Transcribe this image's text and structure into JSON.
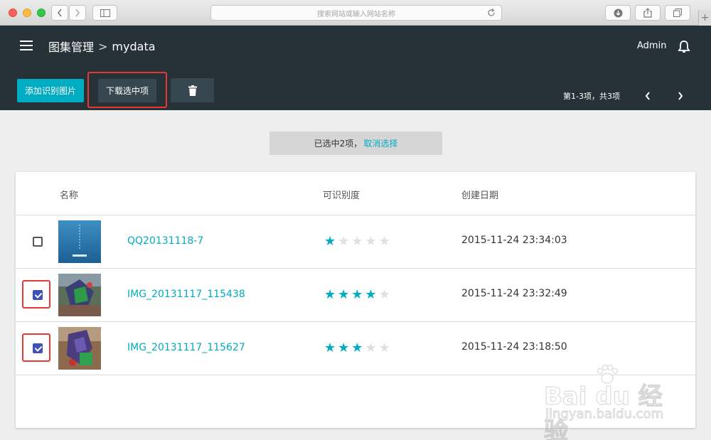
{
  "browser": {
    "url_placeholder": "搜索网站或输入网站名称"
  },
  "header": {
    "breadcrumb_root": "图集管理",
    "breadcrumb_sep": ">",
    "breadcrumb_current": "mydata",
    "user": "Admin"
  },
  "toolbar": {
    "add_label": "添加识别图片",
    "download_label": "下载选中项",
    "pagination_text": "第1-3项，共3项"
  },
  "selection": {
    "text": "已选中2项，",
    "cancel_label": "取消选择"
  },
  "table": {
    "columns": [
      "名称",
      "可识别度",
      "创建日期"
    ],
    "rows": [
      {
        "name": "QQ20131118-7",
        "rating": 1,
        "max_rating": 5,
        "date": "2015-11-24 23:34:03",
        "checked": false
      },
      {
        "name": "IMG_20131117_115438",
        "rating": 4,
        "max_rating": 5,
        "date": "2015-11-24 23:32:49",
        "checked": true
      },
      {
        "name": "IMG_20131117_115627",
        "rating": 3,
        "max_rating": 5,
        "date": "2015-11-24 23:18:50",
        "checked": true
      }
    ]
  },
  "colors": {
    "header_bg": "#263238",
    "accent": "#00acc1",
    "checkbox": "#3f51b5",
    "highlight": "#e53935"
  },
  "watermark": {
    "logo": "Bai du 经验",
    "sub": "jingyan.baidu.com"
  }
}
